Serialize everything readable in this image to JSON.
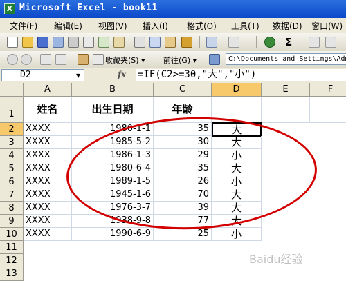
{
  "window": {
    "title": "Microsoft Excel - book11",
    "icon": "excel-icon"
  },
  "menu": [
    "文件(F)",
    "编辑(E)",
    "视图(V)",
    "插入(I)",
    "格式(O)",
    "工具(T)",
    "数据(D)",
    "窗口(W)"
  ],
  "toolbar2": {
    "favorites": "收藏夹(S) ▾",
    "goto": "前往(G) ▾",
    "address": "C:\\Documents and Settings\\Adm"
  },
  "formula_bar": {
    "name_box": "D2",
    "fx": "fx",
    "formula": "=IF(C2>=30,\"大\",\"小\")"
  },
  "columns": [
    "A",
    "B",
    "C",
    "D",
    "E",
    "F"
  ],
  "rows": [
    "1",
    "2",
    "3",
    "4",
    "5",
    "6",
    "7",
    "8",
    "9",
    "10",
    "11",
    "12",
    "13"
  ],
  "headers": {
    "name": "姓名",
    "birth": "出生日期",
    "age": "年龄"
  },
  "data": [
    {
      "name": "XXXX",
      "birth": "1980-1-1",
      "age": "35",
      "size": "大"
    },
    {
      "name": "XXXX",
      "birth": "1985-5-2",
      "age": "30",
      "size": "大"
    },
    {
      "name": "XXXX",
      "birth": "1986-1-3",
      "age": "29",
      "size": "小"
    },
    {
      "name": "XXXX",
      "birth": "1980-6-4",
      "age": "35",
      "size": "大"
    },
    {
      "name": "XXXX",
      "birth": "1989-1-5",
      "age": "26",
      "size": "小"
    },
    {
      "name": "XXXX",
      "birth": "1945-1-6",
      "age": "70",
      "size": "大"
    },
    {
      "name": "XXXX",
      "birth": "1976-3-7",
      "age": "39",
      "size": "大"
    },
    {
      "name": "XXXX",
      "birth": "1938-9-8",
      "age": "77",
      "size": "大"
    },
    {
      "name": "XXXX",
      "birth": "1990-6-9",
      "age": "25",
      "size": "小"
    }
  ],
  "watermark": "Baidu经验",
  "colors": {
    "title_bar": "#0b49c9",
    "annotation": "#d30000",
    "active_header": "#f7c96a"
  }
}
